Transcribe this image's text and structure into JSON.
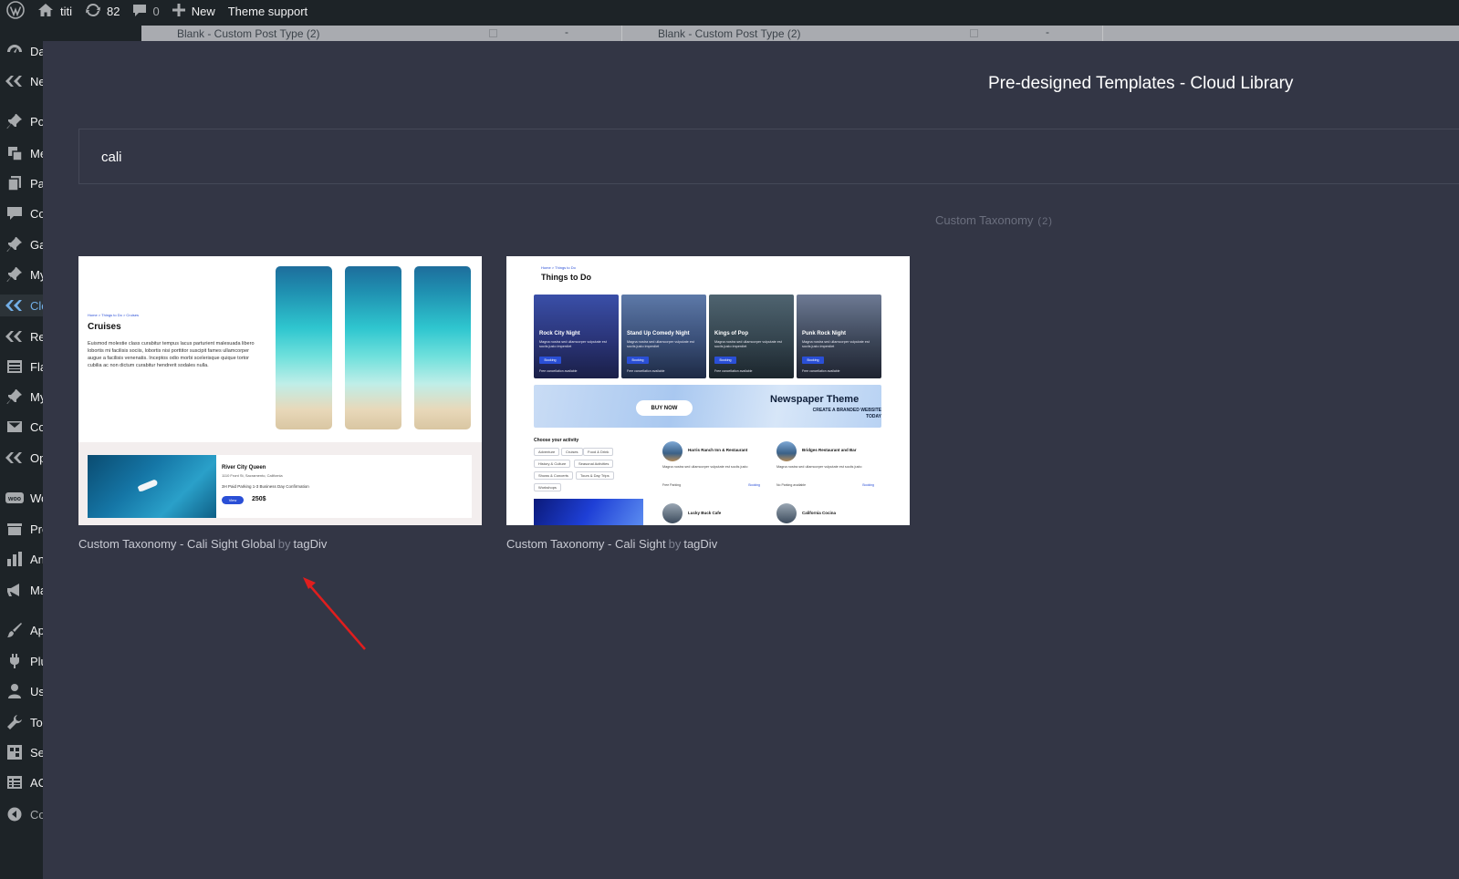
{
  "admin_bar": {
    "site_name": "titi",
    "updates_count": "82",
    "comments_count": "0",
    "new_label": "New",
    "theme_support_label": "Theme support"
  },
  "admin_menu": {
    "items": [
      {
        "label": "Da",
        "icon": "dashboard-icon"
      },
      {
        "label": "Ne",
        "icon": "tagdiv-icon"
      },
      {
        "label": "Po",
        "icon": "pin-icon"
      },
      {
        "label": "Me",
        "icon": "media-icon"
      },
      {
        "label": "Pa",
        "icon": "pages-icon"
      },
      {
        "label": "Co",
        "icon": "comment-icon"
      },
      {
        "label": "Ga",
        "icon": "pin-icon"
      },
      {
        "label": "My",
        "icon": "pin-icon"
      },
      {
        "label": "Clo",
        "icon": "tagdiv-icon"
      },
      {
        "label": "Re",
        "icon": "tagdiv-icon"
      },
      {
        "label": "Fla",
        "icon": "table-icon"
      },
      {
        "label": "My",
        "icon": "pin-icon"
      },
      {
        "label": "Co",
        "icon": "mail-icon"
      },
      {
        "label": "Op",
        "icon": "tagdiv-icon"
      },
      {
        "label": "Wo",
        "icon": "woo-icon"
      },
      {
        "label": "Pro",
        "icon": "products-icon"
      },
      {
        "label": "An",
        "icon": "analytics-icon"
      },
      {
        "label": "Ma",
        "icon": "megaphone-icon"
      },
      {
        "label": "Ap",
        "icon": "brush-icon"
      },
      {
        "label": "Plu",
        "icon": "plugin-icon"
      },
      {
        "label": "Us",
        "icon": "users-icon"
      },
      {
        "label": "To",
        "icon": "wrench-icon"
      },
      {
        "label": "Se",
        "icon": "settings-icon"
      },
      {
        "label": "AC",
        "icon": "acf-icon"
      },
      {
        "label": "Co",
        "icon": "collapse-icon"
      }
    ]
  },
  "background_rows": [
    {
      "title": "Blank - Custom Post Type (2)",
      "value": "-"
    },
    {
      "title": "Blank - Custom Post Type (2)",
      "value": "-"
    }
  ],
  "modal": {
    "title": "Pre-designed Templates - Cloud Library",
    "search_value": "cali",
    "category_filter": {
      "name": "Custom Taxonomy",
      "count": "(2)"
    }
  },
  "templates": [
    {
      "name": "Custom Taxonomy - Cali Sight Global",
      "by": "by",
      "author": "tagDiv",
      "preview": {
        "crumbs": "Home > Things to Do > Cruises",
        "title": "Cruises",
        "text": "Euismod molestie class curabitur tempus lacus parturient malesuada libero lobortis mi facilisis sociis, lobortis nisi porttitor suscipit fames ullamcorper augue a facilisis venenatis. Inceptos odio morbi scelerisque quique tortor cubilia ac non dictum curabitur hendrerit sodales nulla.",
        "listing_name": "River City Queen",
        "listing_address": "1110 Front St, Sacramento, California",
        "listing_meta": "3H   Paid Parking   1-3 Business Day Confirmation",
        "view_label": "View",
        "price": "250$"
      }
    },
    {
      "name": "Custom Taxonomy - Cali Sight",
      "by": "by",
      "author": "tagDiv",
      "preview": {
        "crumbs": "Home > Things to Do",
        "title": "Things to Do",
        "events": [
          {
            "title": "Rock City Night",
            "desc": "Magna nostra sed ullamcorper vulputate est sociis justo imperdiet",
            "button": "Booking",
            "note": "Free cancellation available"
          },
          {
            "title": "Stand Up Comedy Night",
            "desc": "Magna nostra sed ullamcorper vulputate est sociis justo imperdiet",
            "button": "Booking",
            "note": "Free cancellation available"
          },
          {
            "title": "Kings of Pop",
            "desc": "Magna nostra sed ullamcorper vulputate est sociis justo imperdiet",
            "button": "Booking",
            "note": "Free cancellation available"
          },
          {
            "title": "Punk Rock Night",
            "desc": "Magna nostra sed ullamcorper vulputate est sociis justo imperdiet",
            "button": "Booking",
            "note": "Free cancellation available"
          }
        ],
        "banner_button": "BUY NOW",
        "banner_title": "Newspaper Theme",
        "banner_subtitle": "CREATE A BRANDED WEBSITE TODAY",
        "activity_label": "Choose your activity",
        "chips": [
          "Adventure",
          "Cruises",
          "Food & Drink",
          "History & Culture",
          "Seasonal Activities",
          "Shows & Concerts",
          "Tours & Day Trips",
          "Workshops"
        ],
        "places": [
          {
            "name": "Harris Ranch Inn & Restaurant",
            "desc": "Magna nostra sed ullamcorper vulputate est sociis justo",
            "footer": "Free Parking",
            "link": "Booking"
          },
          {
            "name": "Bridges Restaurant and Bar",
            "desc": "Magna nostra sed ullamcorper vulputate est sociis justo",
            "footer": "No Parking available",
            "link": "Booking"
          },
          {
            "name": "Lucky Buck Cafe"
          },
          {
            "name": "California Cocina"
          }
        ]
      }
    }
  ],
  "colors": {
    "modal_bg": "#333645",
    "admin_bg": "#1d2327",
    "accent_blue": "#2a4fd6",
    "annotation_red": "#e01e1e"
  }
}
